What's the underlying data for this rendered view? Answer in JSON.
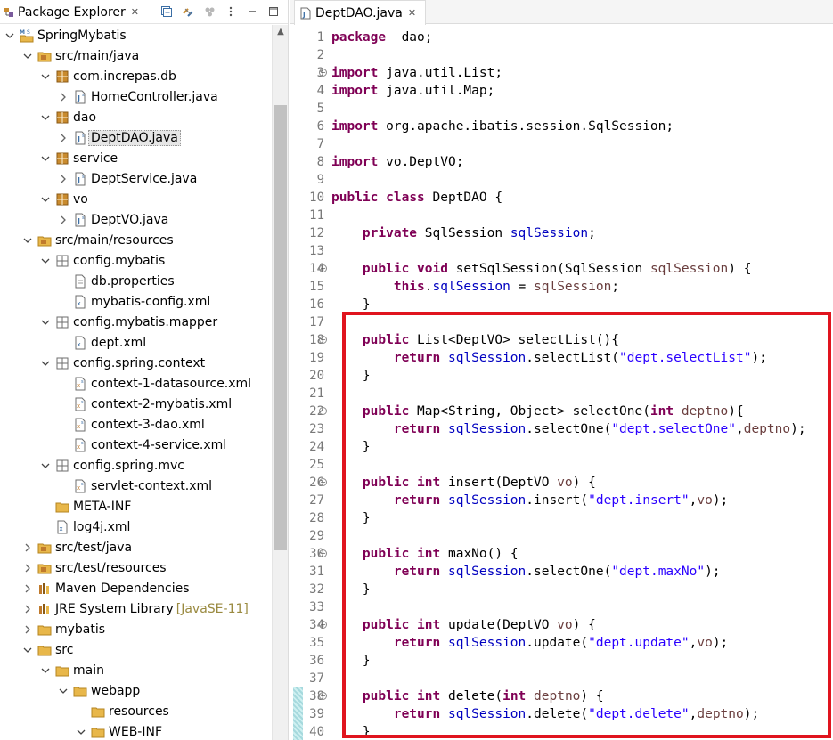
{
  "explorer": {
    "tab_title": "Package Explorer",
    "tab_close": "✕",
    "toolbar": [
      "collapse-all",
      "link-with-editor",
      "filter",
      "view-menu",
      "minimize",
      "maximize"
    ],
    "tree": [
      {
        "indent": 0,
        "twisty": "open",
        "icon": "project-icon",
        "label": "SpringMybatis"
      },
      {
        "indent": 1,
        "twisty": "open",
        "icon": "source-folder-icon",
        "label": "src/main/java"
      },
      {
        "indent": 2,
        "twisty": "open",
        "icon": "package-icon",
        "label": "com.increpas.db"
      },
      {
        "indent": 3,
        "twisty": "closed",
        "icon": "java-file-icon",
        "label": "HomeController.java"
      },
      {
        "indent": 2,
        "twisty": "open",
        "icon": "package-icon",
        "label": "dao"
      },
      {
        "indent": 3,
        "twisty": "closed",
        "icon": "java-file-icon",
        "label": "DeptDAO.java",
        "selected": true
      },
      {
        "indent": 2,
        "twisty": "open",
        "icon": "package-icon",
        "label": "service"
      },
      {
        "indent": 3,
        "twisty": "closed",
        "icon": "java-file-icon",
        "label": "DeptService.java"
      },
      {
        "indent": 2,
        "twisty": "open",
        "icon": "package-icon",
        "label": "vo"
      },
      {
        "indent": 3,
        "twisty": "closed",
        "icon": "java-file-icon",
        "label": "DeptVO.java"
      },
      {
        "indent": 1,
        "twisty": "open",
        "icon": "source-folder-icon",
        "label": "src/main/resources"
      },
      {
        "indent": 2,
        "twisty": "open",
        "icon": "resource-package-icon",
        "label": "config.mybatis"
      },
      {
        "indent": 3,
        "twisty": "none",
        "icon": "properties-file-icon",
        "label": "db.properties"
      },
      {
        "indent": 3,
        "twisty": "none",
        "icon": "xml-file-icon",
        "label": "mybatis-config.xml"
      },
      {
        "indent": 2,
        "twisty": "open",
        "icon": "resource-package-icon",
        "label": "config.mybatis.mapper"
      },
      {
        "indent": 3,
        "twisty": "none",
        "icon": "xml-file-icon",
        "label": "dept.xml"
      },
      {
        "indent": 2,
        "twisty": "open",
        "icon": "resource-package-icon",
        "label": "config.spring.context"
      },
      {
        "indent": 3,
        "twisty": "none",
        "icon": "spring-xml-icon",
        "label": "context-1-datasource.xml"
      },
      {
        "indent": 3,
        "twisty": "none",
        "icon": "spring-xml-icon",
        "label": "context-2-mybatis.xml"
      },
      {
        "indent": 3,
        "twisty": "none",
        "icon": "spring-xml-icon",
        "label": "context-3-dao.xml"
      },
      {
        "indent": 3,
        "twisty": "none",
        "icon": "spring-xml-icon",
        "label": "context-4-service.xml"
      },
      {
        "indent": 2,
        "twisty": "open",
        "icon": "resource-package-icon",
        "label": "config.spring.mvc"
      },
      {
        "indent": 3,
        "twisty": "none",
        "icon": "spring-xml-icon",
        "label": "servlet-context.xml"
      },
      {
        "indent": 2,
        "twisty": "none",
        "icon": "folder-icon",
        "label": "META-INF"
      },
      {
        "indent": 2,
        "twisty": "none",
        "icon": "xml-file-icon",
        "label": "log4j.xml"
      },
      {
        "indent": 1,
        "twisty": "closed",
        "icon": "source-folder-icon",
        "label": "src/test/java"
      },
      {
        "indent": 1,
        "twisty": "closed",
        "icon": "source-folder-icon",
        "label": "src/test/resources"
      },
      {
        "indent": 1,
        "twisty": "closed",
        "icon": "library-icon",
        "label": "Maven Dependencies"
      },
      {
        "indent": 1,
        "twisty": "closed",
        "icon": "library-icon",
        "label": "JRE System Library",
        "decoration": "[JavaSE-11]"
      },
      {
        "indent": 1,
        "twisty": "closed",
        "icon": "folder-icon",
        "label": "mybatis"
      },
      {
        "indent": 1,
        "twisty": "open",
        "icon": "folder-icon",
        "label": "src"
      },
      {
        "indent": 2,
        "twisty": "open",
        "icon": "folder-icon",
        "label": "main"
      },
      {
        "indent": 3,
        "twisty": "open",
        "icon": "folder-icon",
        "label": "webapp"
      },
      {
        "indent": 4,
        "twisty": "none",
        "icon": "folder-icon",
        "label": "resources"
      },
      {
        "indent": 4,
        "twisty": "open",
        "icon": "folder-icon",
        "label": "WEB-INF"
      }
    ]
  },
  "editor": {
    "tab_title": "DeptDAO.java",
    "tab_close": "✕",
    "fold_lines": [
      3,
      14,
      18,
      22,
      26,
      30,
      34,
      38
    ],
    "lines": [
      {
        "n": "1",
        "t": [
          [
            "kw",
            "package"
          ],
          [
            "",
            "  dao;"
          ]
        ]
      },
      {
        "n": "2",
        "t": []
      },
      {
        "n": "3",
        "t": [
          [
            "kw",
            "import"
          ],
          [
            "",
            " java.util.List;"
          ]
        ]
      },
      {
        "n": "4",
        "t": [
          [
            "kw",
            "import"
          ],
          [
            "",
            " java.util.Map;"
          ]
        ]
      },
      {
        "n": "5",
        "t": []
      },
      {
        "n": "6",
        "t": [
          [
            "kw",
            "import"
          ],
          [
            "",
            " org.apache.ibatis.session.SqlSession;"
          ]
        ]
      },
      {
        "n": "7",
        "t": []
      },
      {
        "n": "8",
        "t": [
          [
            "kw",
            "import"
          ],
          [
            "",
            " vo.DeptVO;"
          ]
        ]
      },
      {
        "n": "9",
        "t": []
      },
      {
        "n": "10",
        "t": [
          [
            "kw",
            "public"
          ],
          [
            "",
            " "
          ],
          [
            "kw",
            "class"
          ],
          [
            "",
            " DeptDAO {"
          ]
        ]
      },
      {
        "n": "11",
        "t": []
      },
      {
        "n": "12",
        "t": [
          [
            "",
            "    "
          ],
          [
            "kw",
            "private"
          ],
          [
            "",
            " SqlSession "
          ],
          [
            "fld",
            "sqlSession"
          ],
          [
            "",
            ";"
          ]
        ]
      },
      {
        "n": "13",
        "t": []
      },
      {
        "n": "14",
        "t": [
          [
            "",
            "    "
          ],
          [
            "kw",
            "public"
          ],
          [
            "",
            " "
          ],
          [
            "kw",
            "void"
          ],
          [
            "",
            " setSqlSession(SqlSession "
          ],
          [
            "prm",
            "sqlSession"
          ],
          [
            "",
            ") {"
          ]
        ]
      },
      {
        "n": "15",
        "t": [
          [
            "",
            "        "
          ],
          [
            "kw",
            "this"
          ],
          [
            "",
            "."
          ],
          [
            "fld",
            "sqlSession"
          ],
          [
            "",
            " = "
          ],
          [
            "prm",
            "sqlSession"
          ],
          [
            "",
            ";"
          ]
        ]
      },
      {
        "n": "16",
        "t": [
          [
            "",
            "    }"
          ]
        ]
      },
      {
        "n": "17",
        "t": []
      },
      {
        "n": "18",
        "t": [
          [
            "",
            "    "
          ],
          [
            "kw",
            "public"
          ],
          [
            "",
            " List<DeptVO> selectList(){"
          ]
        ]
      },
      {
        "n": "19",
        "t": [
          [
            "",
            "        "
          ],
          [
            "kw",
            "return"
          ],
          [
            "",
            " "
          ],
          [
            "fld",
            "sqlSession"
          ],
          [
            "",
            ".selectList("
          ],
          [
            "str",
            "\"dept.selectList\""
          ],
          [
            "",
            ");"
          ]
        ]
      },
      {
        "n": "20",
        "t": [
          [
            "",
            "    }"
          ]
        ]
      },
      {
        "n": "21",
        "t": []
      },
      {
        "n": "22",
        "t": [
          [
            "",
            "    "
          ],
          [
            "kw",
            "public"
          ],
          [
            "",
            " Map<String, Object> selectOne("
          ],
          [
            "kw",
            "int"
          ],
          [
            "",
            " "
          ],
          [
            "prm",
            "deptno"
          ],
          [
            "",
            "){"
          ]
        ]
      },
      {
        "n": "23",
        "t": [
          [
            "",
            "        "
          ],
          [
            "kw",
            "return"
          ],
          [
            "",
            " "
          ],
          [
            "fld",
            "sqlSession"
          ],
          [
            "",
            ".selectOne("
          ],
          [
            "str",
            "\"dept.selectOne\""
          ],
          [
            "",
            ","
          ],
          [
            "prm",
            "deptno"
          ],
          [
            "",
            ");"
          ]
        ]
      },
      {
        "n": "24",
        "t": [
          [
            "",
            "    }"
          ]
        ]
      },
      {
        "n": "25",
        "t": []
      },
      {
        "n": "26",
        "t": [
          [
            "",
            "    "
          ],
          [
            "kw",
            "public"
          ],
          [
            "",
            " "
          ],
          [
            "kw",
            "int"
          ],
          [
            "",
            " insert(DeptVO "
          ],
          [
            "prm",
            "vo"
          ],
          [
            "",
            ") {"
          ]
        ]
      },
      {
        "n": "27",
        "t": [
          [
            "",
            "        "
          ],
          [
            "kw",
            "return"
          ],
          [
            "",
            " "
          ],
          [
            "fld",
            "sqlSession"
          ],
          [
            "",
            ".insert("
          ],
          [
            "str",
            "\"dept.insert\""
          ],
          [
            "",
            ","
          ],
          [
            "prm",
            "vo"
          ],
          [
            "",
            ");"
          ]
        ]
      },
      {
        "n": "28",
        "t": [
          [
            "",
            "    }"
          ]
        ]
      },
      {
        "n": "29",
        "t": []
      },
      {
        "n": "30",
        "t": [
          [
            "",
            "    "
          ],
          [
            "kw",
            "public"
          ],
          [
            "",
            " "
          ],
          [
            "kw",
            "int"
          ],
          [
            "",
            " maxNo() {"
          ]
        ]
      },
      {
        "n": "31",
        "t": [
          [
            "",
            "        "
          ],
          [
            "kw",
            "return"
          ],
          [
            "",
            " "
          ],
          [
            "fld",
            "sqlSession"
          ],
          [
            "",
            ".selectOne("
          ],
          [
            "str",
            "\"dept.maxNo\""
          ],
          [
            "",
            ");"
          ]
        ]
      },
      {
        "n": "32",
        "t": [
          [
            "",
            "    }"
          ]
        ]
      },
      {
        "n": "33",
        "t": []
      },
      {
        "n": "34",
        "t": [
          [
            "",
            "    "
          ],
          [
            "kw",
            "public"
          ],
          [
            "",
            " "
          ],
          [
            "kw",
            "int"
          ],
          [
            "",
            " update(DeptVO "
          ],
          [
            "prm",
            "vo"
          ],
          [
            "",
            ") {"
          ]
        ]
      },
      {
        "n": "35",
        "t": [
          [
            "",
            "        "
          ],
          [
            "kw",
            "return"
          ],
          [
            "",
            " "
          ],
          [
            "fld",
            "sqlSession"
          ],
          [
            "",
            ".update("
          ],
          [
            "str",
            "\"dept.update\""
          ],
          [
            "",
            ","
          ],
          [
            "prm",
            "vo"
          ],
          [
            "",
            ");"
          ]
        ]
      },
      {
        "n": "36",
        "t": [
          [
            "",
            "    }"
          ]
        ]
      },
      {
        "n": "37",
        "t": []
      },
      {
        "n": "38",
        "t": [
          [
            "",
            "    "
          ],
          [
            "kw",
            "public"
          ],
          [
            "",
            " "
          ],
          [
            "kw",
            "int"
          ],
          [
            "",
            " delete("
          ],
          [
            "kw",
            "int"
          ],
          [
            "",
            " "
          ],
          [
            "prm",
            "deptno"
          ],
          [
            "",
            ") {"
          ]
        ]
      },
      {
        "n": "39",
        "t": [
          [
            "",
            "        "
          ],
          [
            "kw",
            "return"
          ],
          [
            "",
            " "
          ],
          [
            "fld",
            "sqlSession"
          ],
          [
            "",
            ".delete("
          ],
          [
            "str",
            "\"dept.delete\""
          ],
          [
            "",
            ","
          ],
          [
            "prm",
            "deptno"
          ],
          [
            "",
            ");"
          ]
        ]
      },
      {
        "n": "40",
        "t": [
          [
            "",
            "    }"
          ]
        ]
      }
    ]
  },
  "colors": {
    "keyword": "#7f0055",
    "field": "#0000c0",
    "string": "#2a00ff",
    "parameter": "#6a3e3e",
    "highlight_box": "#e0141e"
  }
}
